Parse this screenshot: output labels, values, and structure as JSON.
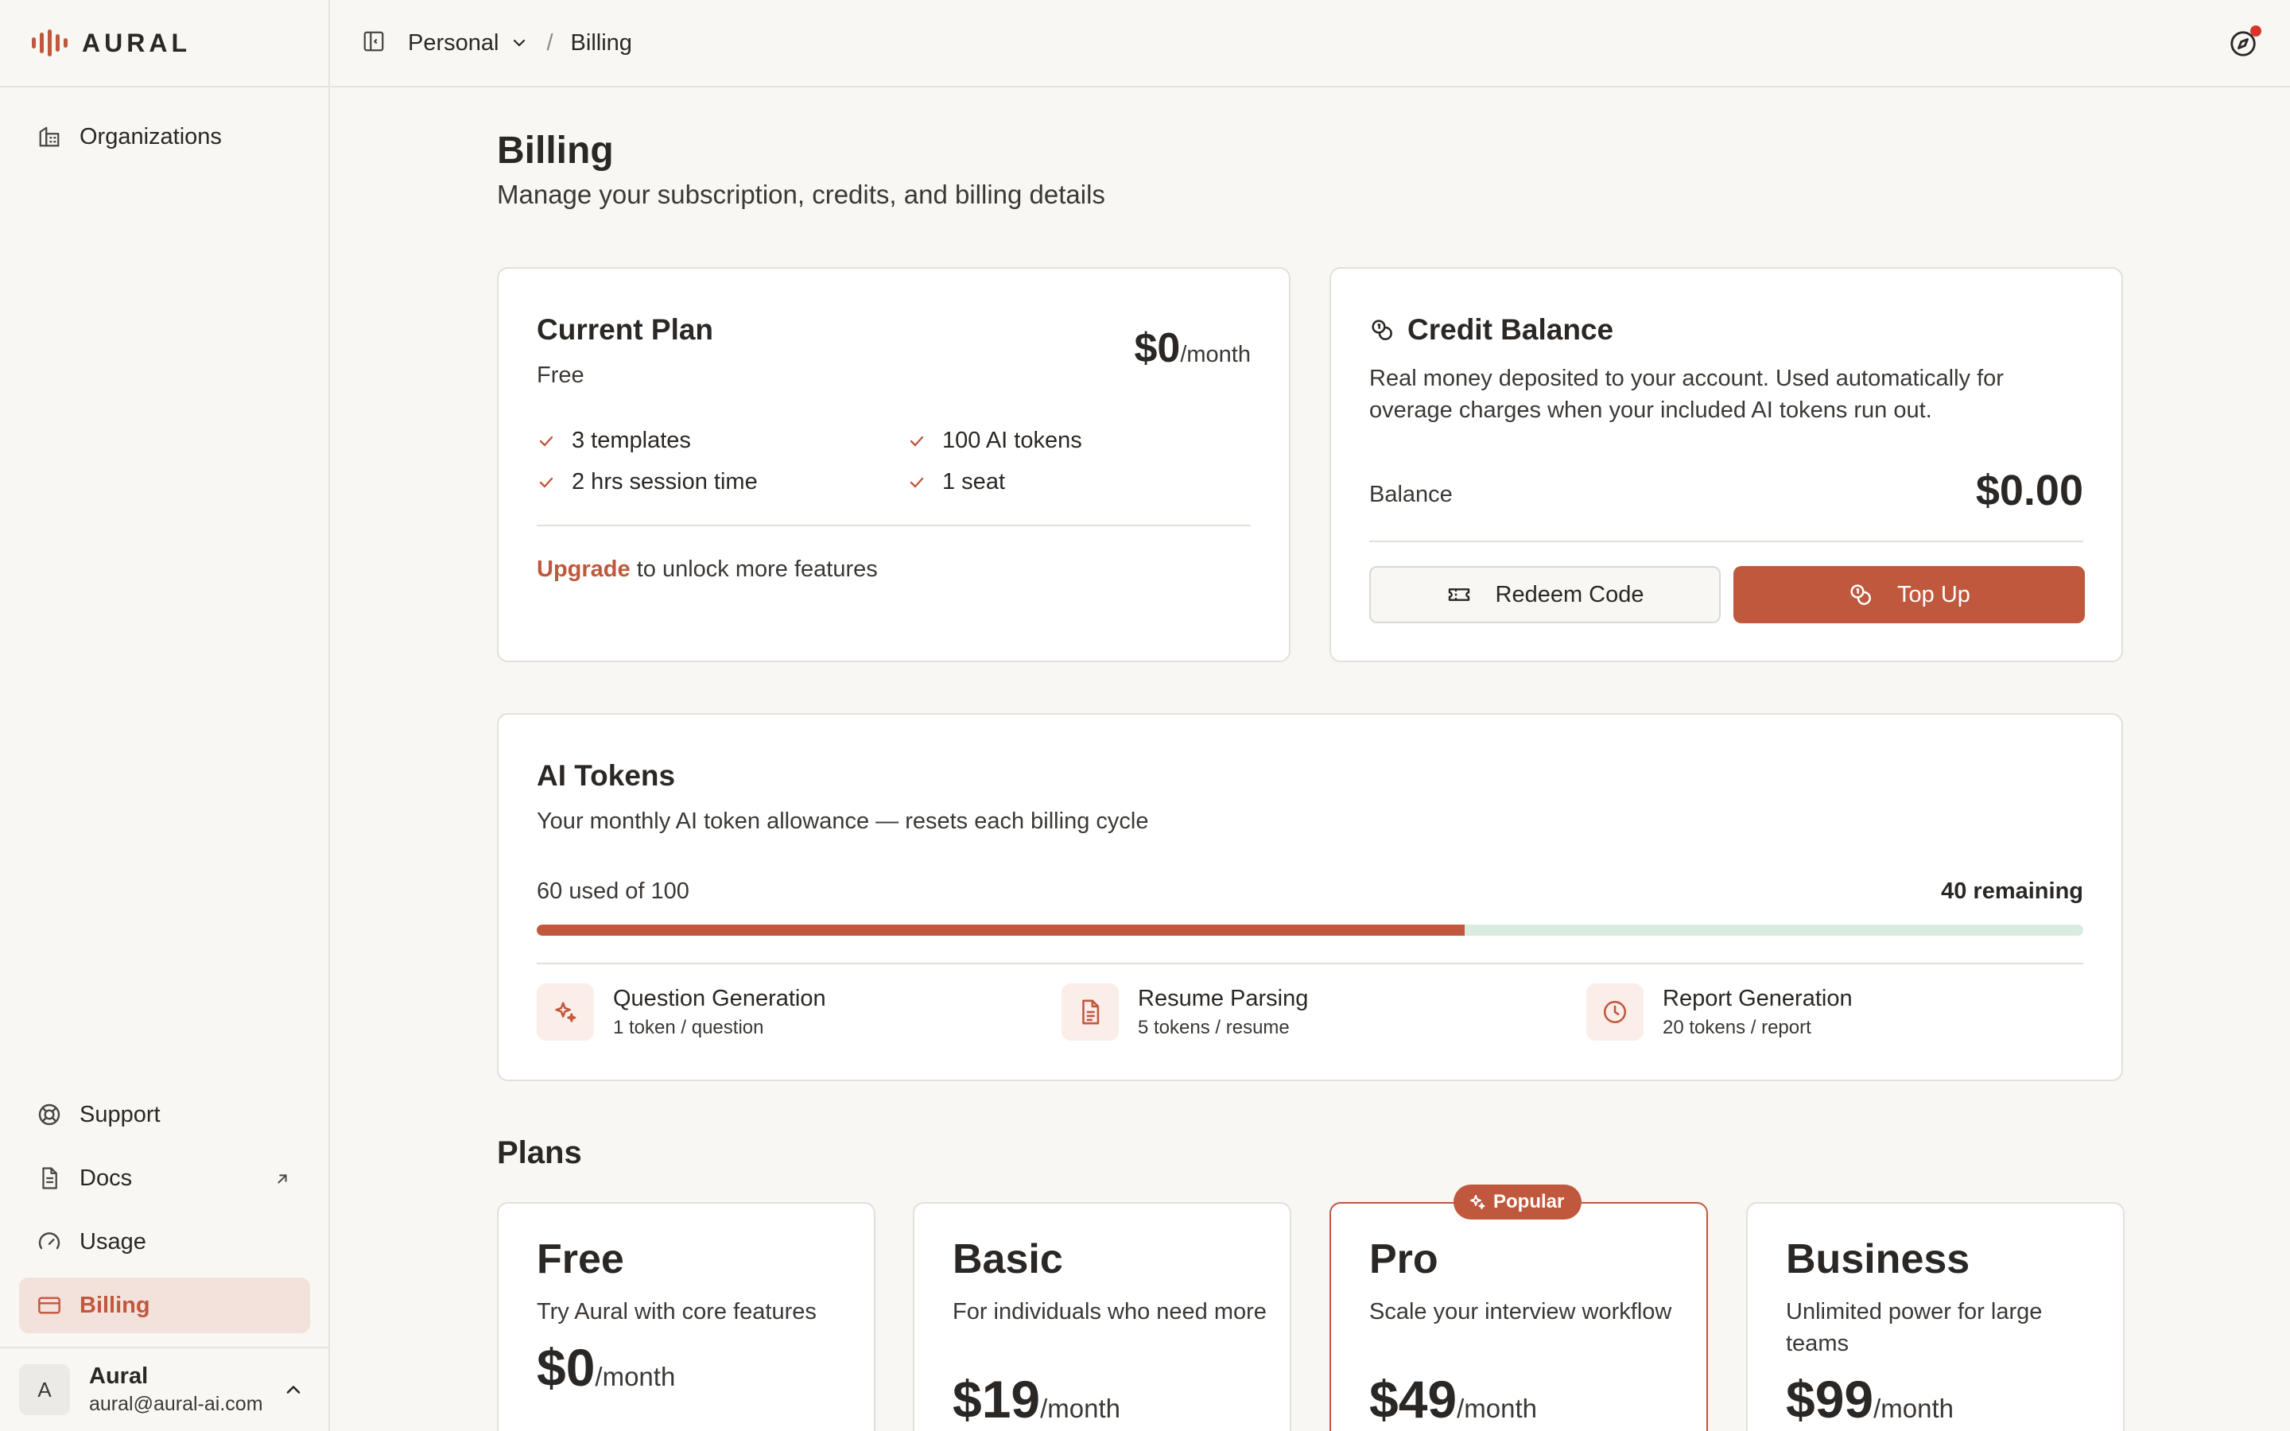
{
  "brand": {
    "name": "AURAL"
  },
  "sidebar": {
    "top_items": [
      {
        "label": "Organizations",
        "icon": "building-icon"
      }
    ],
    "bottom_items": [
      {
        "label": "Support",
        "icon": "lifebuoy-icon"
      },
      {
        "label": "Docs",
        "icon": "document-icon",
        "external": true
      },
      {
        "label": "Usage",
        "icon": "gauge-icon"
      },
      {
        "label": "Billing",
        "icon": "credit-card-icon",
        "active": true
      }
    ],
    "user": {
      "initial": "A",
      "name": "Aural",
      "email": "aural@aural-ai.com"
    }
  },
  "topbar": {
    "workspace": "Personal",
    "separator": "/",
    "current": "Billing"
  },
  "page": {
    "title": "Billing",
    "subtitle": "Manage your subscription, credits, and billing details"
  },
  "current_plan": {
    "title": "Current Plan",
    "plan_name": "Free",
    "price": "$0",
    "period": "/month",
    "features": [
      "3 templates",
      "100 AI tokens",
      "2 hrs session time",
      "1 seat"
    ],
    "upgrade_link": "Upgrade",
    "upgrade_text": " to unlock more features"
  },
  "credit_balance": {
    "title": "Credit Balance",
    "description": "Real money deposited to your account. Used automatically for overage charges when your included AI tokens run out.",
    "balance_label": "Balance",
    "balance_value": "$0.00",
    "redeem_label": "Redeem Code",
    "topup_label": "Top Up"
  },
  "ai_tokens": {
    "title": "AI Tokens",
    "description": "Your monthly AI token allowance — resets each billing cycle",
    "used_text": "60 used of 100",
    "remaining_text": "40 remaining",
    "used": 60,
    "total": 100,
    "usage": [
      {
        "name": "Question Generation",
        "rate": "1 token / question",
        "icon": "sparkle-icon"
      },
      {
        "name": "Resume Parsing",
        "rate": "5 tokens / resume",
        "icon": "file-text-icon"
      },
      {
        "name": "Report Generation",
        "rate": "20 tokens / report",
        "icon": "clock-icon"
      }
    ]
  },
  "plans": {
    "title": "Plans",
    "badge": "Popular",
    "items": [
      {
        "name": "Free",
        "description": "Try Aural with core features",
        "price": "$0",
        "period": "/month"
      },
      {
        "name": "Basic",
        "description": "For individuals who need more",
        "price": "$19",
        "period": "/month"
      },
      {
        "name": "Pro",
        "description": "Scale your interview workflow",
        "price": "$49",
        "period": "/month",
        "popular": true
      },
      {
        "name": "Business",
        "description": "Unlimited power for large teams",
        "price": "$99",
        "period": "/month"
      }
    ]
  },
  "colors": {
    "accent": "#C0583D",
    "progress_track": "#D9ECDF",
    "background": "#F8F7F4"
  }
}
